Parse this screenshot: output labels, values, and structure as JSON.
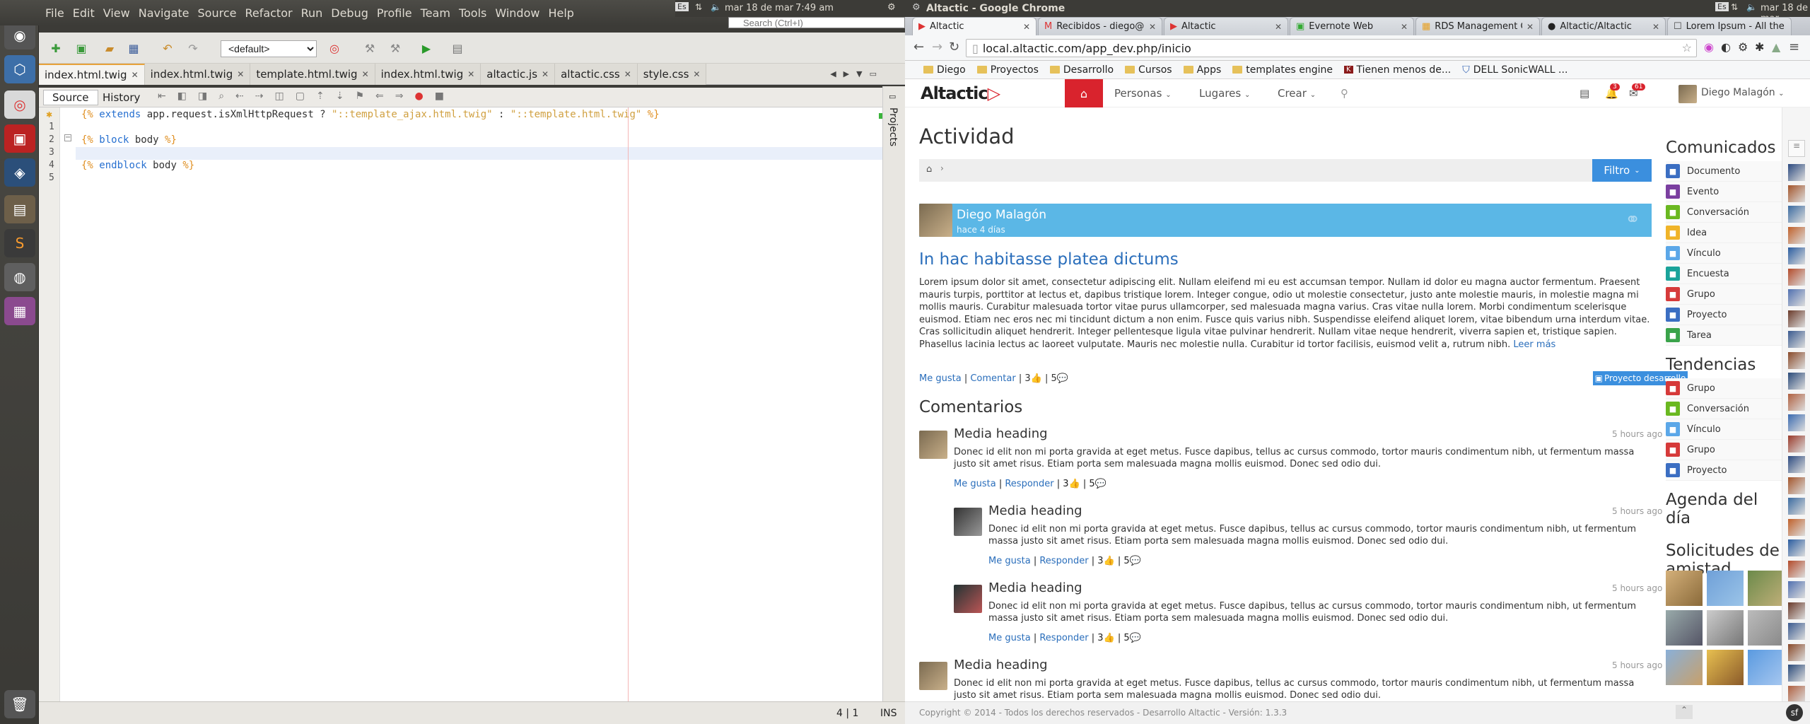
{
  "netbeans": {
    "menu": [
      "File",
      "Edit",
      "View",
      "Navigate",
      "Source",
      "Refactor",
      "Run",
      "Debug",
      "Profile",
      "Team",
      "Tools",
      "Window",
      "Help"
    ],
    "search_placeholder": "Search (Ctrl+I)",
    "config": "<default>",
    "tabs": [
      {
        "label": "index.html.twig",
        "active": true
      },
      {
        "label": "index.html.twig",
        "active": false
      },
      {
        "label": "template.html.twig",
        "active": false
      },
      {
        "label": "index.html.twig",
        "active": false
      },
      {
        "label": "altactic.js",
        "active": false
      },
      {
        "label": "altactic.css",
        "active": false
      },
      {
        "label": "style.css",
        "active": false
      }
    ],
    "subtabs": {
      "source": "Source",
      "history": "History"
    },
    "projects_label": "Projects",
    "code": {
      "line1": {
        "open": "{%",
        "kw": "extends",
        "plain": " app.request.isXmlHttpRequest ? ",
        "s1": "\"::template_ajax.html.twig\"",
        "mid": " : ",
        "s2": "\"::template.html.twig\"",
        "close": " %}"
      },
      "line3": {
        "open": "{%",
        "kw": "block",
        "plain": " body ",
        "close": "%}"
      },
      "line5": {
        "open": "{%",
        "kw": "endblock",
        "plain": " body ",
        "close": "%}"
      }
    },
    "line_numbers": [
      "1",
      "2",
      "3",
      "4",
      "5"
    ],
    "status": {
      "position": "4 | 1",
      "mode": "INS"
    }
  },
  "system": {
    "lang": "Es",
    "date": "mar 18 de mar",
    "time": "7:49 am",
    "window_title": "Altactic - Google Chrome"
  },
  "chrome": {
    "tabs": [
      {
        "label": "Altactic",
        "active": true
      },
      {
        "label": "Recibidos - diego@altz",
        "active": false
      },
      {
        "label": "Altactic",
        "active": false
      },
      {
        "label": "Evernote Web",
        "active": false
      },
      {
        "label": "RDS Management Con",
        "active": false
      },
      {
        "label": "Altactic/Altactic",
        "active": false
      },
      {
        "label": "Lorem Ipsum - All the F",
        "active": false
      }
    ],
    "url": "local.altactic.com/app_dev.php/inicio",
    "bookmarks": [
      "Diego",
      "Proyectos",
      "Desarrollo",
      "Cursos",
      "Apps",
      "templates engine",
      "Tienen menos de...",
      "DELL SonicWALL ..."
    ]
  },
  "site": {
    "brand": "Altactic",
    "nav": {
      "personas": "Personas",
      "lugares": "Lugares",
      "crear": "Crear"
    },
    "badges": {
      "notif": "3",
      "msgs": "61"
    },
    "user": "Diego Malagón",
    "page_title": "Actividad",
    "filter_button": "Filtro",
    "post": {
      "author": "Diego Malagón",
      "time": "hace 4 días",
      "title": "In hac habitasse platea dictums",
      "body": "Lorem ipsum dolor sit amet, consectetur adipiscing elit. Nullam eleifend mi eu est accumsan tempor. Nullam id dolor eu magna auctor fermentum. Praesent mauris turpis, porttitor at lectus et, dapibus tristique lorem. Integer congue, odio ut molestie consectetur, justo ante molestie mauris, in molestie magna mi mollis mauris. Curabitur malesuada tortor vitae purus ullamcorper, sed malesuada magna varius. Cras vitae nulla lorem. Morbi condimentum scelerisque euismod. Etiam nec eros nec mi tincidunt dictum a non enim. Fusce quis varius nibh. Suspendisse eleifend aliquet lorem, vitae bibendum urna interdum vitae. Cras sollicitudin aliquet hendrerit. Integer pellentesque ligula vitae pulvinar hendrerit. Nullam vitae neque hendrerit, viverra sapien et, tristique sapien. Phasellus lacinia lectus ac laoreet vulputate. Mauris nec molestie nulla. Curabitur id tortor facilisis, euismod velit a, rutrum nibh.",
      "read_more": "Leer más",
      "like": "Me gusta",
      "comment": "Comentar",
      "likes": "3",
      "comments": "5",
      "project_button": "Proyecto desarrollo"
    },
    "comments_title": "Comentarios",
    "comments": [
      {
        "heading": "Media heading",
        "time": "5 hours ago",
        "body": "Donec id elit non mi porta gravida at eget metus. Fusce dapibus, tellus ac cursus commodo, tortor mauris condimentum nibh, ut fermentum massa justo sit amet risus. Etiam porta sem malesuada magna mollis euismod. Donec sed odio dui.",
        "like": "Me gusta",
        "reply": "Responder",
        "likes": "3",
        "count": "5"
      },
      {
        "heading": "Media heading",
        "time": "5 hours ago",
        "body": "Donec id elit non mi porta gravida at eget metus. Fusce dapibus, tellus ac cursus commodo, tortor mauris condimentum nibh, ut fermentum massa justo sit amet risus. Etiam porta sem malesuada magna mollis euismod. Donec sed odio dui.",
        "like": "Me gusta",
        "reply": "Responder",
        "likes": "3",
        "count": "5"
      },
      {
        "heading": "Media heading",
        "time": "5 hours ago",
        "body": "Donec id elit non mi porta gravida at eget metus. Fusce dapibus, tellus ac cursus commodo, tortor mauris condimentum nibh, ut fermentum massa justo sit amet risus. Etiam porta sem malesuada magna mollis euismod. Donec sed odio dui.",
        "like": "Me gusta",
        "reply": "Responder",
        "likes": "3",
        "count": "5"
      },
      {
        "heading": "Media heading",
        "time": "5 hours ago",
        "body": "Donec id elit non mi porta gravida at eget metus. Fusce dapibus, tellus ac cursus commodo, tortor mauris condimentum nibh, ut fermentum massa justo sit amet risus. Etiam porta sem malesuada magna mollis euismod. Donec sed odio dui."
      }
    ],
    "comunicados_title": "Comunicados",
    "comunicados": [
      {
        "label": "Documento",
        "color": "#3b6ec2"
      },
      {
        "label": "Evento",
        "color": "#7b3fa0"
      },
      {
        "label": "Conversación",
        "color": "#6ab820"
      },
      {
        "label": "Idea",
        "color": "#f0b429"
      },
      {
        "label": "Vínculo",
        "color": "#5ba7e8"
      },
      {
        "label": "Encuesta",
        "color": "#1aa39a"
      },
      {
        "label": "Grupo",
        "color": "#d63a3a"
      },
      {
        "label": "Proyecto",
        "color": "#3b6ec2"
      },
      {
        "label": "Tarea",
        "color": "#3aa34a"
      }
    ],
    "tendencias_title": "Tendencias",
    "tendencias": [
      {
        "label": "Grupo",
        "color": "#d63a3a"
      },
      {
        "label": "Conversación",
        "color": "#6ab820"
      },
      {
        "label": "Vínculo",
        "color": "#5ba7e8"
      },
      {
        "label": "Grupo",
        "color": "#d63a3a"
      },
      {
        "label": "Proyecto",
        "color": "#3b6ec2"
      }
    ],
    "agenda_title": "Agenda del día",
    "solicitudes_title": "Solicitudes de amistad",
    "footer": "Copyright © 2014 - Todos los derechos reservados - Desarrollo Altactic - Versión: 1.3.3"
  }
}
